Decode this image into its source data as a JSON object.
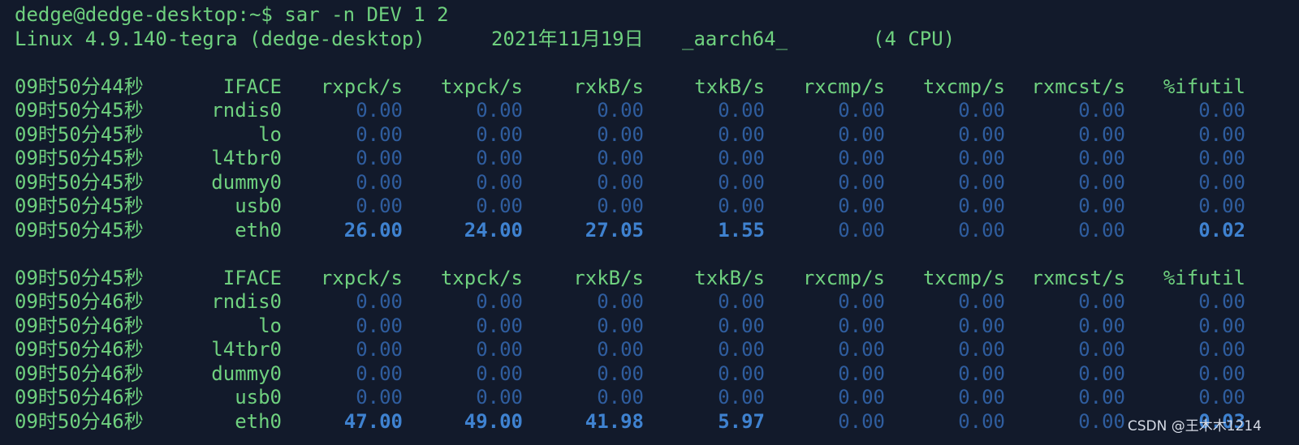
{
  "window": {
    "prompt": "dedge@dedge-desktop:~$ sar -n DEV 1 2",
    "sysinfo": {
      "kernel": "Linux 4.9.140-tegra (dedge-desktop)",
      "date": "2021年11月19日",
      "arch": "_aarch64_",
      "cpus": "(4 CPU)"
    }
  },
  "table_header_labels": [
    "IFACE",
    "rxpck/s",
    "txpck/s",
    "rxkB/s",
    "txkB/s",
    "rxcmp/s",
    "txcmp/s",
    "rxmcst/s",
    "%ifutil"
  ],
  "blocks": [
    {
      "header_time": "09时50分44秒",
      "rows": [
        {
          "time": "09时50分45秒",
          "iface": "rndis0",
          "values": [
            "0.00",
            "0.00",
            "0.00",
            "0.00",
            "0.00",
            "0.00",
            "0.00",
            "0.00"
          ]
        },
        {
          "time": "09时50分45秒",
          "iface": "lo",
          "values": [
            "0.00",
            "0.00",
            "0.00",
            "0.00",
            "0.00",
            "0.00",
            "0.00",
            "0.00"
          ]
        },
        {
          "time": "09时50分45秒",
          "iface": "l4tbr0",
          "values": [
            "0.00",
            "0.00",
            "0.00",
            "0.00",
            "0.00",
            "0.00",
            "0.00",
            "0.00"
          ]
        },
        {
          "time": "09时50分45秒",
          "iface": "dummy0",
          "values": [
            "0.00",
            "0.00",
            "0.00",
            "0.00",
            "0.00",
            "0.00",
            "0.00",
            "0.00"
          ]
        },
        {
          "time": "09时50分45秒",
          "iface": "usb0",
          "values": [
            "0.00",
            "0.00",
            "0.00",
            "0.00",
            "0.00",
            "0.00",
            "0.00",
            "0.00"
          ]
        },
        {
          "time": "09时50分45秒",
          "iface": "eth0",
          "values": [
            "26.00",
            "24.00",
            "27.05",
            "1.55",
            "0.00",
            "0.00",
            "0.00",
            "0.02"
          ]
        }
      ]
    },
    {
      "header_time": "09时50分45秒",
      "rows": [
        {
          "time": "09时50分46秒",
          "iface": "rndis0",
          "values": [
            "0.00",
            "0.00",
            "0.00",
            "0.00",
            "0.00",
            "0.00",
            "0.00",
            "0.00"
          ]
        },
        {
          "time": "09时50分46秒",
          "iface": "lo",
          "values": [
            "0.00",
            "0.00",
            "0.00",
            "0.00",
            "0.00",
            "0.00",
            "0.00",
            "0.00"
          ]
        },
        {
          "time": "09时50分46秒",
          "iface": "l4tbr0",
          "values": [
            "0.00",
            "0.00",
            "0.00",
            "0.00",
            "0.00",
            "0.00",
            "0.00",
            "0.00"
          ]
        },
        {
          "time": "09时50分46秒",
          "iface": "dummy0",
          "values": [
            "0.00",
            "0.00",
            "0.00",
            "0.00",
            "0.00",
            "0.00",
            "0.00",
            "0.00"
          ]
        },
        {
          "time": "09时50分46秒",
          "iface": "usb0",
          "values": [
            "0.00",
            "0.00",
            "0.00",
            "0.00",
            "0.00",
            "0.00",
            "0.00",
            "0.00"
          ]
        },
        {
          "time": "09时50分46秒",
          "iface": "eth0",
          "values": [
            "47.00",
            "49.00",
            "41.98",
            "5.97",
            "0.00",
            "0.00",
            "0.00",
            "0.03"
          ]
        }
      ]
    }
  ],
  "watermark": "CSDN @王木木1214",
  "colors": {
    "background": "#121a2b",
    "text_green": "#6fd17f",
    "value_dim_blue": "#2f5d9e",
    "value_bright_blue": "#3f82d0"
  }
}
